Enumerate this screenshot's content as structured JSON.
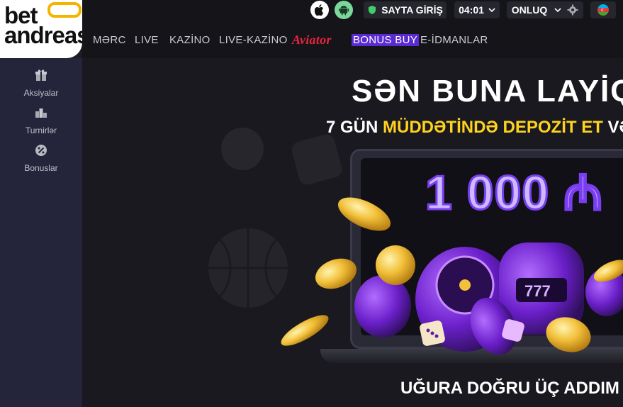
{
  "header": {
    "login_label": "SAYTA GİRİŞ",
    "time": "04:01",
    "odds_format": "ONLUQ"
  },
  "logo": {
    "line1": "bet",
    "line2": "andreas"
  },
  "nav": {
    "items": [
      "MƏRC",
      "LIVE",
      "KAZİNO",
      "LIVE-KAZİNO",
      "Aviator",
      "BONUS BUY",
      "E-İDMANLAR"
    ]
  },
  "sidebar": {
    "items": [
      {
        "label": "Aksiyalar",
        "icon": "gift-icon"
      },
      {
        "label": "Turnirlər",
        "icon": "podium-icon"
      },
      {
        "label": "Bonuslar",
        "icon": "bonus-icon"
      }
    ]
  },
  "banner": {
    "headline": "SƏN BUNA LAYİQSƏ",
    "subhead_1": "7 GÜN ",
    "subhead_2": "MÜDDƏTİNDƏ DEPOZİT ET",
    "subhead_3": " VƏ",
    "amount": "1 000 ₼",
    "steps_title": "UĞURA DOĞRU ÜÇ ADDIM"
  },
  "colors": {
    "accent_yellow": "#ffd21e",
    "aviator_red": "#e8243c",
    "bonus_purple": "#5a2bd1",
    "android_green": "#6fd08a",
    "shield_green": "#3fcf6a"
  }
}
